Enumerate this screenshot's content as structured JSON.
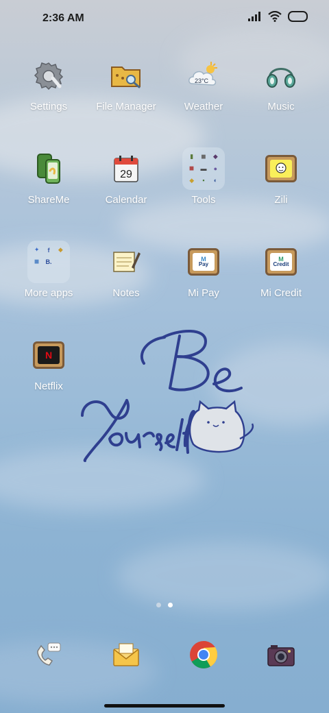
{
  "status_bar": {
    "time": "2:36 AM"
  },
  "apps": [
    {
      "label": "Settings",
      "icon": "gear-icon"
    },
    {
      "label": "File Manager",
      "icon": "folder-search-icon"
    },
    {
      "label": "Weather",
      "icon": "weather-cloud-sun-icon",
      "temperature": "23°C"
    },
    {
      "label": "Music",
      "icon": "headphones-icon"
    },
    {
      "label": "ShareMe",
      "icon": "share-icon"
    },
    {
      "label": "Calendar",
      "icon": "calendar-icon",
      "day": "29"
    },
    {
      "label": "Tools",
      "icon": "folder-icon"
    },
    {
      "label": "Zili",
      "icon": "zili-icon"
    },
    {
      "label": "More apps",
      "icon": "folder-icon"
    },
    {
      "label": "Notes",
      "icon": "notes-icon"
    },
    {
      "label": "Mi Pay",
      "icon": "mi-pay-icon",
      "icon_text": "Pay"
    },
    {
      "label": "Mi Credit",
      "icon": "mi-credit-icon",
      "icon_text": "Credit"
    },
    {
      "label": "Netflix",
      "icon": "netflix-icon",
      "icon_text": "N"
    }
  ],
  "dock": [
    {
      "name": "phone",
      "icon": "phone-icon"
    },
    {
      "name": "messages",
      "icon": "envelope-icon"
    },
    {
      "name": "chrome",
      "icon": "chrome-icon"
    },
    {
      "name": "camera",
      "icon": "camera-icon"
    }
  ],
  "wallpaper": {
    "text_line1": "Be",
    "text_line2": "Yourself"
  },
  "page_indicator": {
    "count": 2,
    "active": 2
  },
  "colors": {
    "label": "#ffffff",
    "ink": "#2f3f8f",
    "accent_dot_active": "#ffffff",
    "accent_dot_inactive": "#c8d6e4"
  }
}
